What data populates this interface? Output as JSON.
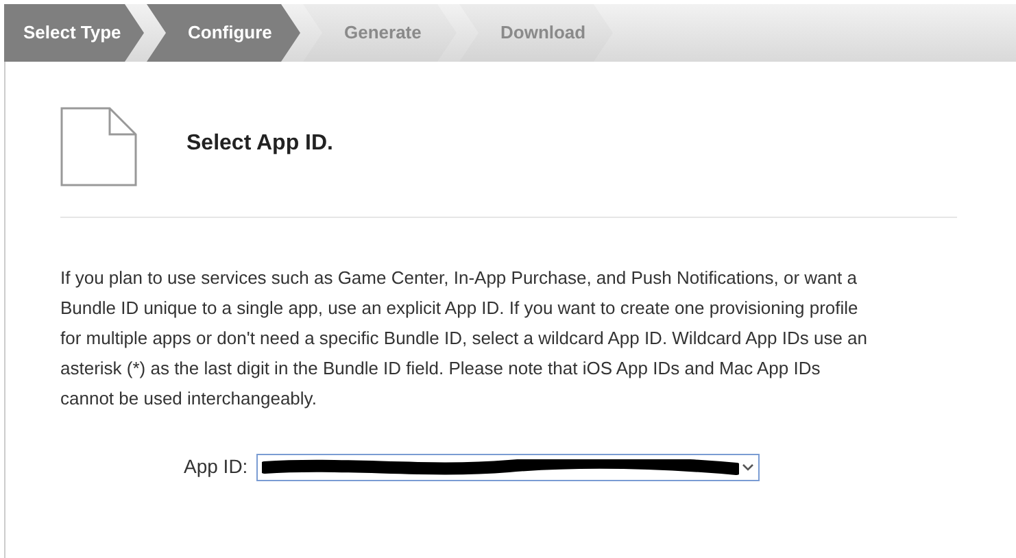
{
  "steps": [
    {
      "label": "Select Type",
      "completed": true
    },
    {
      "label": "Configure",
      "completed": true
    },
    {
      "label": "Generate",
      "completed": false
    },
    {
      "label": "Download",
      "completed": false
    }
  ],
  "title": "Select App ID.",
  "description": "If you plan to use services such as Game Center, In-App Purchase, and Push Notifications, or want a Bundle ID unique to a single app, use an explicit App ID. If you want to create one provisioning profile for multiple apps or don't need a specific Bundle ID, select a wildcard App ID. Wildcard App IDs use an asterisk (*) as the last digit in the Bundle ID field. Please note that iOS App IDs and Mac App IDs cannot be used interchangeably.",
  "app_id": {
    "label": "App ID:"
  }
}
